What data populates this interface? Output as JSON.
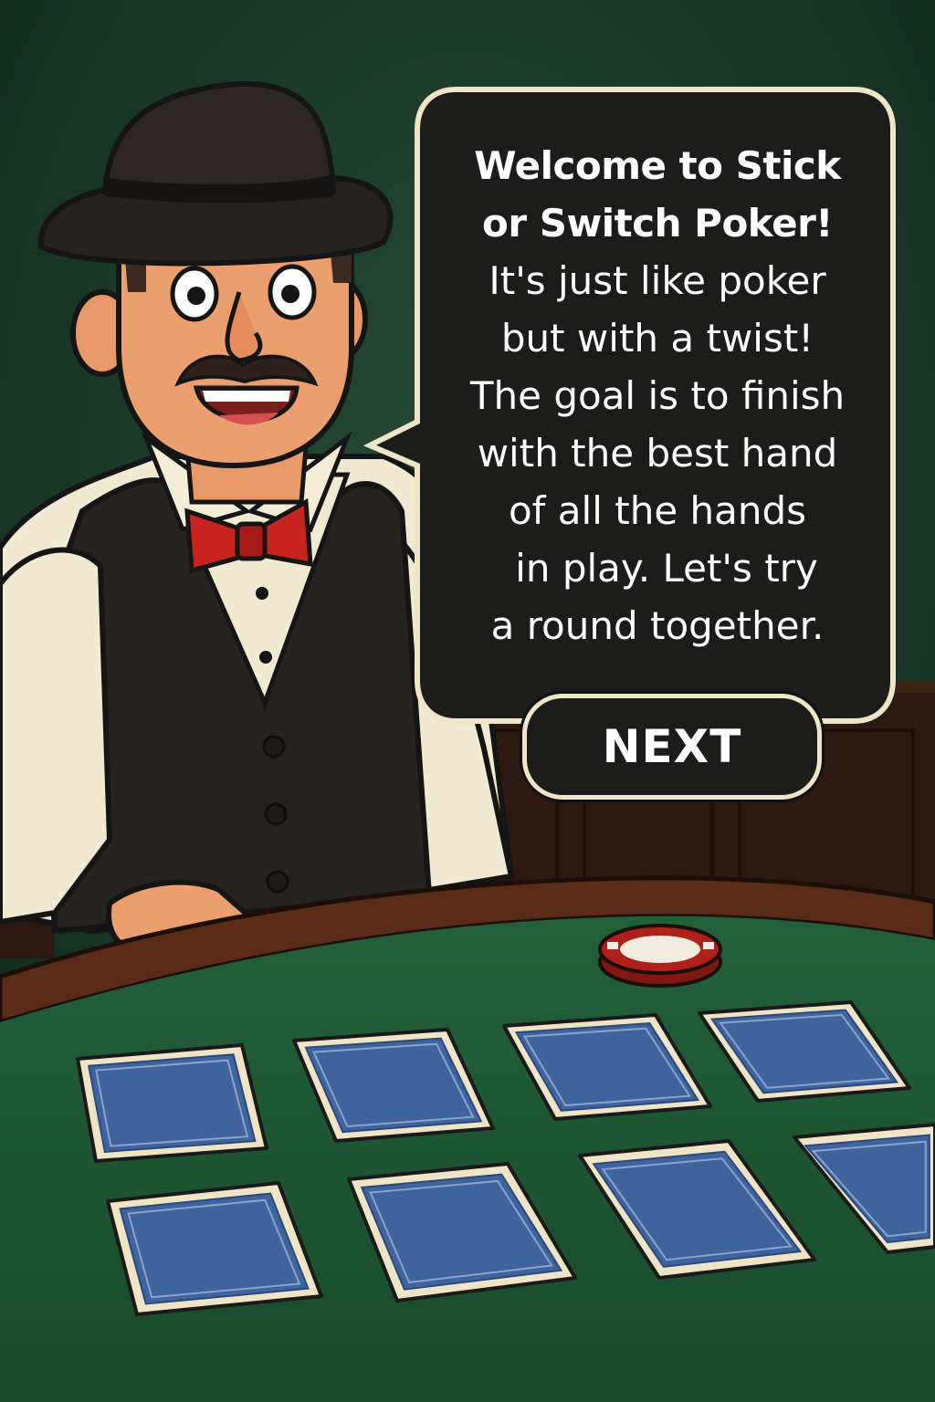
{
  "dialogue": {
    "lines": [
      "Welcome to Stick",
      "or Switch Poker!",
      "It's just like poker",
      "but with a twist!",
      "The goal is to finish",
      "with the best hand",
      "of all the hands",
      "in play. Let's try",
      "a round together."
    ]
  },
  "buttons": {
    "next_label": "NEXT"
  },
  "table": {
    "card_count": 8,
    "chip_count": 1
  },
  "colors": {
    "felt": "#1f5a32",
    "card_back": "#3f639c",
    "card_border": "#efe4c5",
    "bubble": "#1c1c1a",
    "bow_tie": "#c8231f"
  }
}
